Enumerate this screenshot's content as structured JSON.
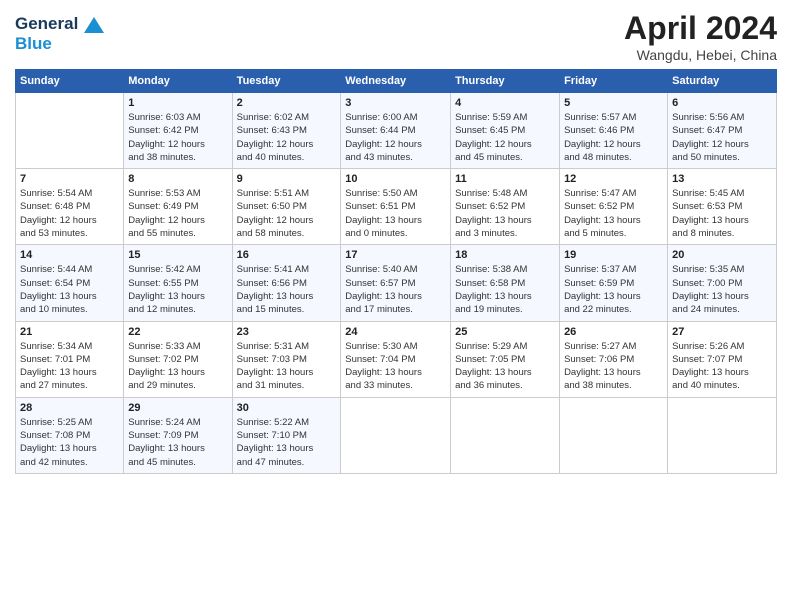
{
  "header": {
    "logo_line1": "General",
    "logo_line2": "Blue",
    "title": "April 2024",
    "location": "Wangdu, Hebei, China"
  },
  "days_of_week": [
    "Sunday",
    "Monday",
    "Tuesday",
    "Wednesday",
    "Thursday",
    "Friday",
    "Saturday"
  ],
  "weeks": [
    [
      {
        "day": "",
        "info": ""
      },
      {
        "day": "1",
        "info": "Sunrise: 6:03 AM\nSunset: 6:42 PM\nDaylight: 12 hours\nand 38 minutes."
      },
      {
        "day": "2",
        "info": "Sunrise: 6:02 AM\nSunset: 6:43 PM\nDaylight: 12 hours\nand 40 minutes."
      },
      {
        "day": "3",
        "info": "Sunrise: 6:00 AM\nSunset: 6:44 PM\nDaylight: 12 hours\nand 43 minutes."
      },
      {
        "day": "4",
        "info": "Sunrise: 5:59 AM\nSunset: 6:45 PM\nDaylight: 12 hours\nand 45 minutes."
      },
      {
        "day": "5",
        "info": "Sunrise: 5:57 AM\nSunset: 6:46 PM\nDaylight: 12 hours\nand 48 minutes."
      },
      {
        "day": "6",
        "info": "Sunrise: 5:56 AM\nSunset: 6:47 PM\nDaylight: 12 hours\nand 50 minutes."
      }
    ],
    [
      {
        "day": "7",
        "info": "Sunrise: 5:54 AM\nSunset: 6:48 PM\nDaylight: 12 hours\nand 53 minutes."
      },
      {
        "day": "8",
        "info": "Sunrise: 5:53 AM\nSunset: 6:49 PM\nDaylight: 12 hours\nand 55 minutes."
      },
      {
        "day": "9",
        "info": "Sunrise: 5:51 AM\nSunset: 6:50 PM\nDaylight: 12 hours\nand 58 minutes."
      },
      {
        "day": "10",
        "info": "Sunrise: 5:50 AM\nSunset: 6:51 PM\nDaylight: 13 hours\nand 0 minutes."
      },
      {
        "day": "11",
        "info": "Sunrise: 5:48 AM\nSunset: 6:52 PM\nDaylight: 13 hours\nand 3 minutes."
      },
      {
        "day": "12",
        "info": "Sunrise: 5:47 AM\nSunset: 6:52 PM\nDaylight: 13 hours\nand 5 minutes."
      },
      {
        "day": "13",
        "info": "Sunrise: 5:45 AM\nSunset: 6:53 PM\nDaylight: 13 hours\nand 8 minutes."
      }
    ],
    [
      {
        "day": "14",
        "info": "Sunrise: 5:44 AM\nSunset: 6:54 PM\nDaylight: 13 hours\nand 10 minutes."
      },
      {
        "day": "15",
        "info": "Sunrise: 5:42 AM\nSunset: 6:55 PM\nDaylight: 13 hours\nand 12 minutes."
      },
      {
        "day": "16",
        "info": "Sunrise: 5:41 AM\nSunset: 6:56 PM\nDaylight: 13 hours\nand 15 minutes."
      },
      {
        "day": "17",
        "info": "Sunrise: 5:40 AM\nSunset: 6:57 PM\nDaylight: 13 hours\nand 17 minutes."
      },
      {
        "day": "18",
        "info": "Sunrise: 5:38 AM\nSunset: 6:58 PM\nDaylight: 13 hours\nand 19 minutes."
      },
      {
        "day": "19",
        "info": "Sunrise: 5:37 AM\nSunset: 6:59 PM\nDaylight: 13 hours\nand 22 minutes."
      },
      {
        "day": "20",
        "info": "Sunrise: 5:35 AM\nSunset: 7:00 PM\nDaylight: 13 hours\nand 24 minutes."
      }
    ],
    [
      {
        "day": "21",
        "info": "Sunrise: 5:34 AM\nSunset: 7:01 PM\nDaylight: 13 hours\nand 27 minutes."
      },
      {
        "day": "22",
        "info": "Sunrise: 5:33 AM\nSunset: 7:02 PM\nDaylight: 13 hours\nand 29 minutes."
      },
      {
        "day": "23",
        "info": "Sunrise: 5:31 AM\nSunset: 7:03 PM\nDaylight: 13 hours\nand 31 minutes."
      },
      {
        "day": "24",
        "info": "Sunrise: 5:30 AM\nSunset: 7:04 PM\nDaylight: 13 hours\nand 33 minutes."
      },
      {
        "day": "25",
        "info": "Sunrise: 5:29 AM\nSunset: 7:05 PM\nDaylight: 13 hours\nand 36 minutes."
      },
      {
        "day": "26",
        "info": "Sunrise: 5:27 AM\nSunset: 7:06 PM\nDaylight: 13 hours\nand 38 minutes."
      },
      {
        "day": "27",
        "info": "Sunrise: 5:26 AM\nSunset: 7:07 PM\nDaylight: 13 hours\nand 40 minutes."
      }
    ],
    [
      {
        "day": "28",
        "info": "Sunrise: 5:25 AM\nSunset: 7:08 PM\nDaylight: 13 hours\nand 42 minutes."
      },
      {
        "day": "29",
        "info": "Sunrise: 5:24 AM\nSunset: 7:09 PM\nDaylight: 13 hours\nand 45 minutes."
      },
      {
        "day": "30",
        "info": "Sunrise: 5:22 AM\nSunset: 7:10 PM\nDaylight: 13 hours\nand 47 minutes."
      },
      {
        "day": "",
        "info": ""
      },
      {
        "day": "",
        "info": ""
      },
      {
        "day": "",
        "info": ""
      },
      {
        "day": "",
        "info": ""
      }
    ]
  ]
}
